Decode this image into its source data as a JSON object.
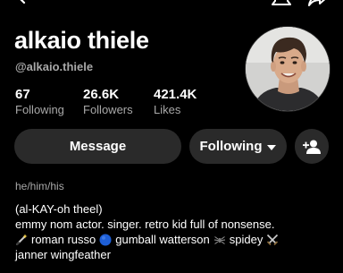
{
  "profile": {
    "display_name": "alkaio thiele",
    "username": "@alkaio.thiele"
  },
  "stats": [
    {
      "count": "67",
      "label": "Following"
    },
    {
      "count": "26.6K",
      "label": "Followers"
    },
    {
      "count": "421.4K",
      "label": "Likes"
    }
  ],
  "actions": {
    "message_label": "Message",
    "following_label": "Following"
  },
  "bio": {
    "pronouns": "he/him/his",
    "line1": "(al-KAY-oh theel)",
    "line2": "emmy nom actor. singer. retro kid full of nonsense.",
    "line3_part1": "roman russo",
    "line3_part2": "gumball watterson",
    "line3_part3": "spidey",
    "line4": "janner wingfeather"
  },
  "icons": {
    "back": "back-arrow-icon",
    "bell": "bell-icon",
    "share": "share-icon",
    "add_friend": "add-friend-icon",
    "wand": "magic-wand-emoji",
    "blue_circle": "blue-circle-emoji",
    "spider": "spider-emoji",
    "swords": "crossed-swords-emoji"
  },
  "colors": {
    "background": "#000000",
    "button": "#2a2a2a",
    "secondary_text": "#a8a8a8",
    "blue_circle": "#1e5fd6"
  }
}
